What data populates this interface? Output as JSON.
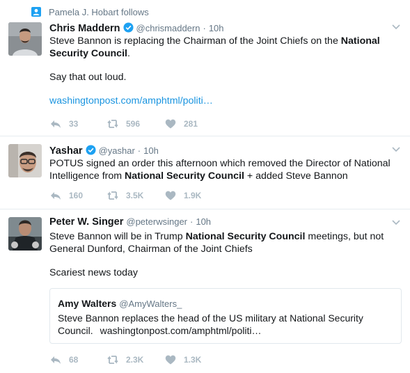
{
  "colors": {
    "muted": "#657786",
    "link": "#1b95e0",
    "action_gray": "#aab8c2",
    "verified_blue": "#1da1f2",
    "context_icon": "#1da1f2"
  },
  "tweets": [
    {
      "context": "Pamela J. Hobart follows",
      "name": "Chris Maddern",
      "verified": true,
      "handle": "@chrismaddern",
      "time": "10h",
      "text_parts": [
        "Steve Bannon is replacing the Chairman of the Joint Chiefs on the ",
        "National Security Council",
        "."
      ],
      "text2": "Say that out loud.",
      "link": "washingtonpost.com/amphtml/politi…",
      "replies": "33",
      "retweets": "596",
      "likes": "281"
    },
    {
      "name": "Yashar",
      "verified": true,
      "handle": "@yashar",
      "time": "10h",
      "text_parts": [
        "POTUS signed an order this afternoon which removed the Director of National Intelligence from ",
        "National Security Council",
        " + added Steve Bannon"
      ],
      "replies": "160",
      "retweets": "3.5K",
      "likes": "1.9K"
    },
    {
      "name": "Peter W. Singer",
      "verified": false,
      "handle": "@peterwsinger",
      "time": "10h",
      "text_parts": [
        "Steve Bannon will be in Trump ",
        "National Security Council",
        " meetings, but not General Dunford, Chairman of the Joint Chiefs"
      ],
      "text2": "Scariest news today",
      "quote": {
        "name": "Amy Walters",
        "handle": "@AmyWalters_",
        "text": "Steve Bannon replaces the head of the US military at National Security Council.",
        "link": "washingtonpost.com/amphtml/politi…"
      },
      "replies": "68",
      "retweets": "2.3K",
      "likes": "1.3K"
    }
  ],
  "separator": "·"
}
